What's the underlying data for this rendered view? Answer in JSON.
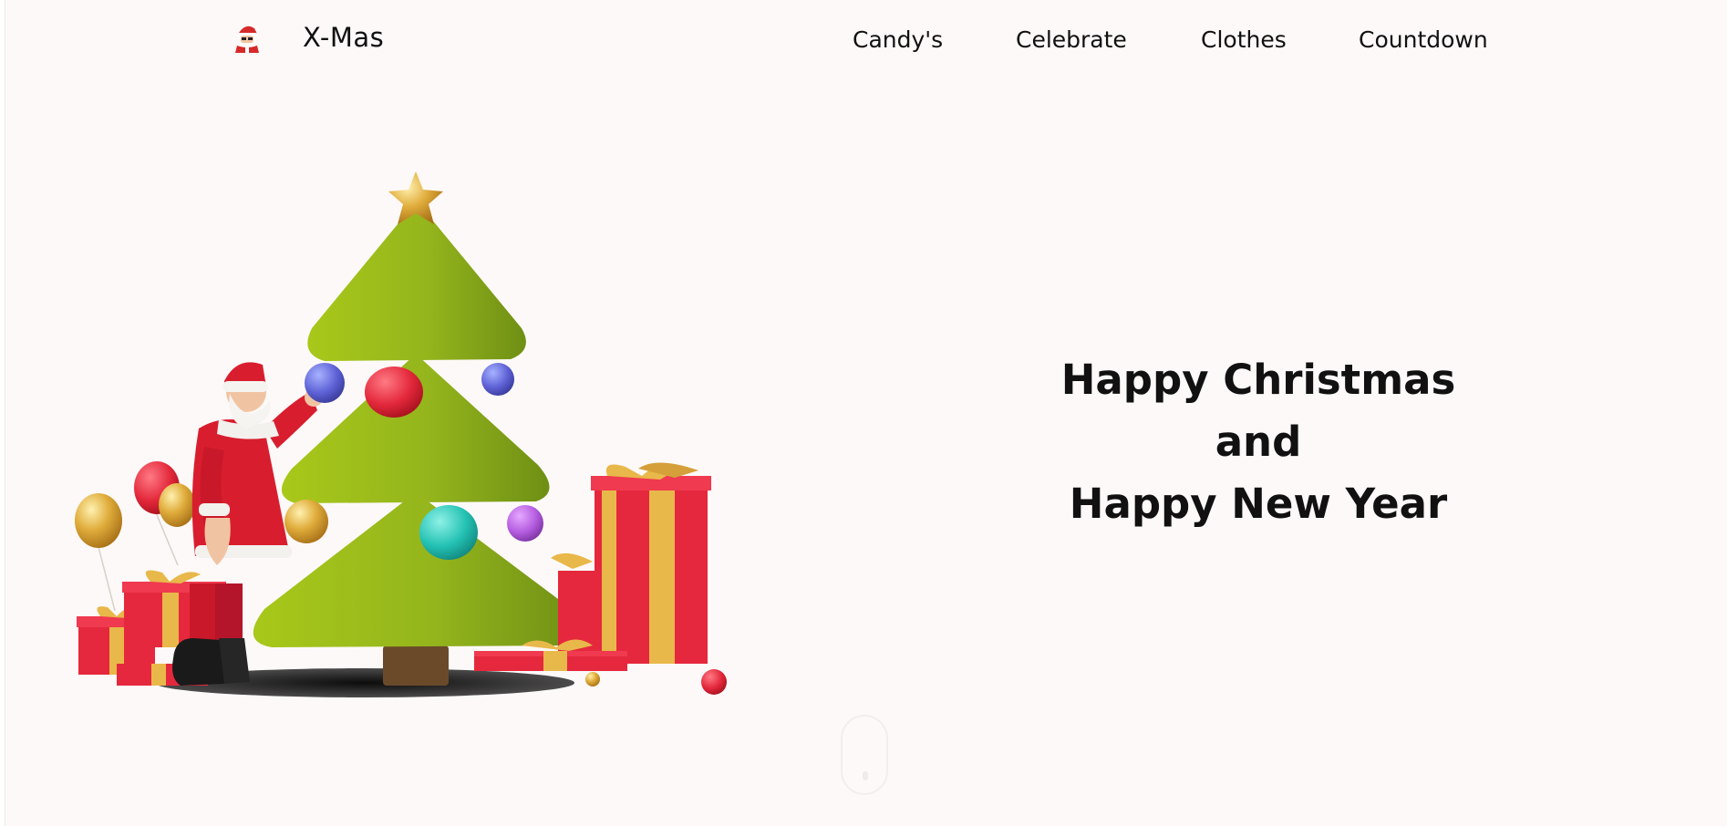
{
  "brand": {
    "name": "X-Mas",
    "logo_icon": "santa-icon"
  },
  "nav": {
    "items": [
      {
        "label": "Candy's"
      },
      {
        "label": "Celebrate"
      },
      {
        "label": "Clothes"
      },
      {
        "label": "Countdown"
      }
    ]
  },
  "hero": {
    "lines": [
      "Happy Christmas",
      "and",
      "Happy New Year"
    ],
    "illustration": "santa-decorating-christmas-tree-illustration"
  },
  "scroll_indicator": {
    "icon": "mouse-scroll-icon"
  },
  "colors": {
    "background": "#fdf9f8",
    "text": "#111111",
    "tree_green": "#8fb51a",
    "gift_red": "#e8283f",
    "ribbon_gold": "#e9b84a"
  }
}
